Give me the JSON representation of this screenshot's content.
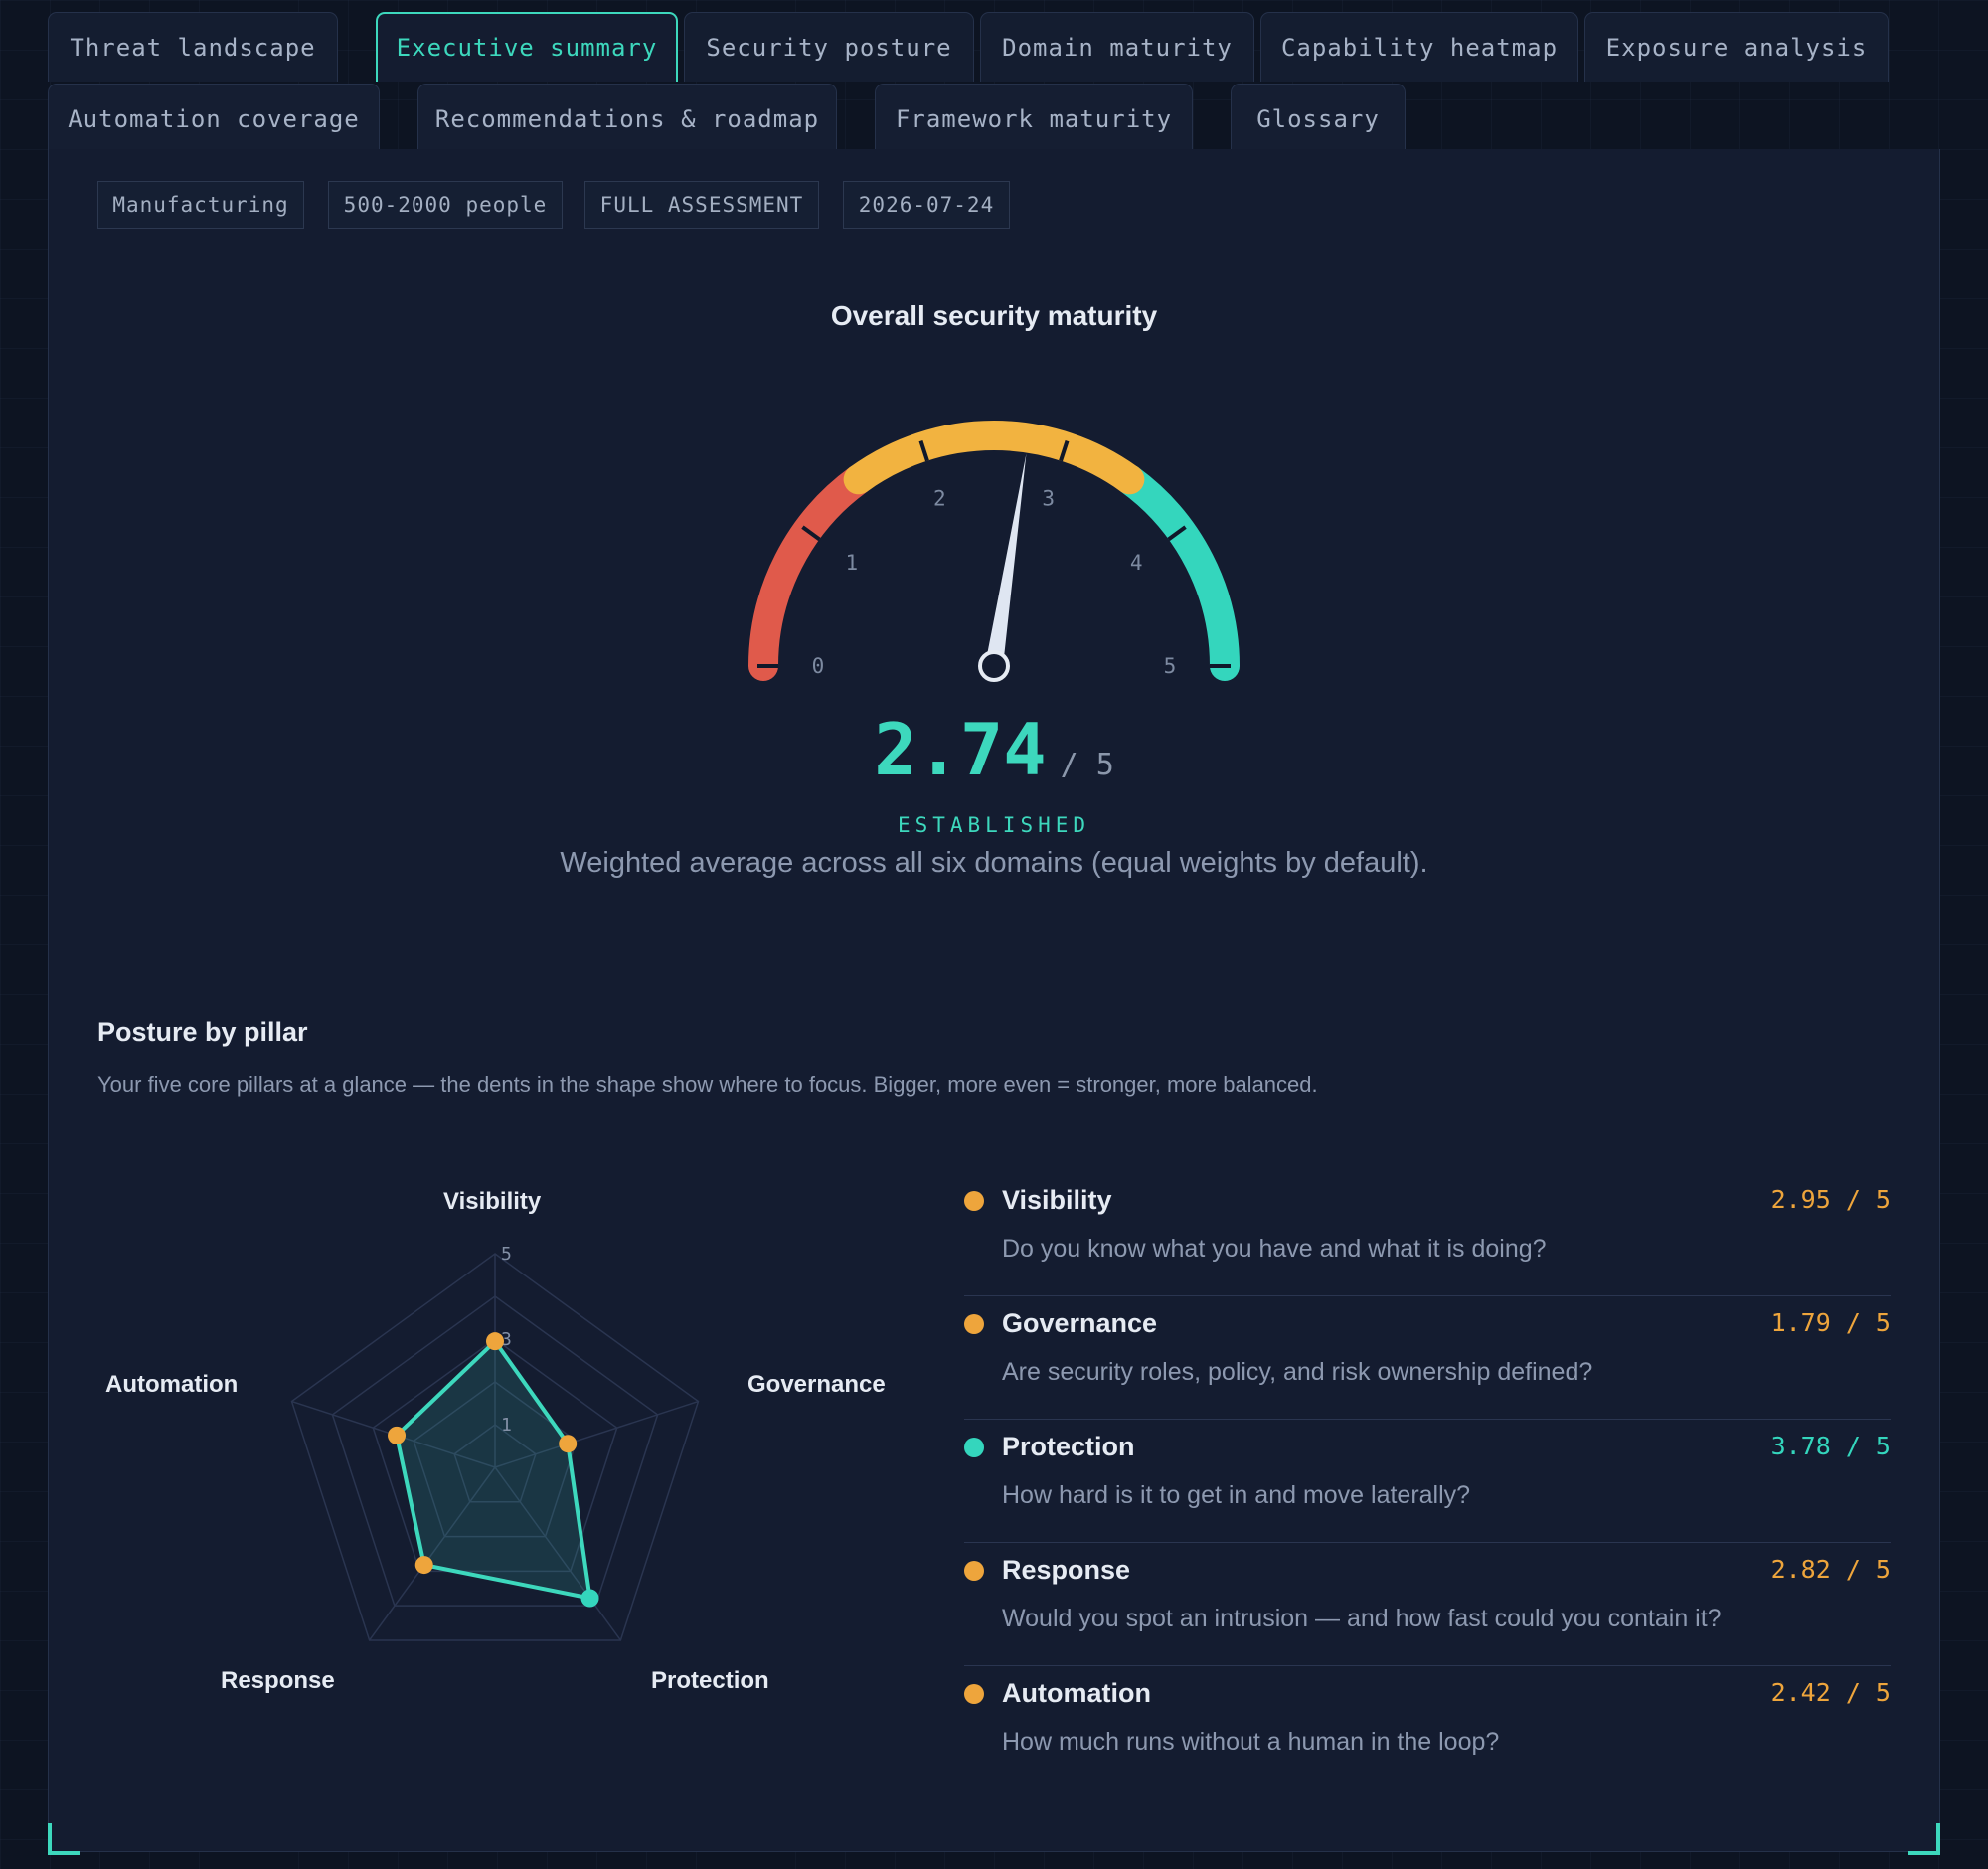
{
  "tabs_row1": [
    {
      "label": "Threat landscape",
      "active": false
    },
    {
      "label": "Executive summary",
      "active": true
    },
    {
      "label": "Security posture",
      "active": false
    },
    {
      "label": "Domain maturity",
      "active": false
    },
    {
      "label": "Capability heatmap",
      "active": false
    },
    {
      "label": "Exposure analysis",
      "active": false
    }
  ],
  "tabs_row2": [
    {
      "label": "Automation coverage",
      "active": false
    },
    {
      "label": "Recommendations & roadmap",
      "active": false
    },
    {
      "label": "Framework maturity",
      "active": false
    },
    {
      "label": "Glossary",
      "active": false
    }
  ],
  "chips": [
    "Manufacturing",
    "500-2000 people",
    "FULL ASSESSMENT",
    "2026-07-24"
  ],
  "gauge": {
    "title": "Overall security maturity",
    "value": 2.74,
    "value_text": "2.74",
    "max_text": "/ 5",
    "max": 5,
    "level": "ESTABLISHED",
    "note": "Weighted average across all six domains (equal weights by default).",
    "tick_labels": [
      "0",
      "1",
      "2",
      "3",
      "4",
      "5"
    ],
    "bands": [
      {
        "from": 0,
        "to": 1.5,
        "color": "#e05a4b"
      },
      {
        "from": 1.5,
        "to": 3.5,
        "color": "#f2b340"
      },
      {
        "from": 3.5,
        "to": 5,
        "color": "#34d6bd"
      }
    ],
    "needle_color": "#dfe6f2"
  },
  "pillars_section": {
    "title": "Posture by pillar",
    "description": "Your five core pillars at a glance — the dents in the shape show where to focus. Bigger, more even = stronger, more balanced."
  },
  "radar": {
    "max": 5,
    "ring_labels": [
      "1",
      "3",
      "5"
    ],
    "axes": [
      "Visibility",
      "Governance",
      "Protection",
      "Response",
      "Automation"
    ]
  },
  "chart_data": {
    "type": "radar",
    "categories": [
      "Visibility",
      "Governance",
      "Protection",
      "Response",
      "Automation"
    ],
    "values": [
      2.95,
      1.79,
      3.78,
      2.82,
      2.42
    ],
    "rlim": [
      0,
      5
    ]
  },
  "pillars": [
    {
      "name": "Visibility",
      "question": "Do you know what you have and what it is doing?",
      "score": "2.95 / 5",
      "color": "#eea53c"
    },
    {
      "name": "Governance",
      "question": "Are security roles, policy, and risk ownership defined?",
      "score": "1.79 / 5",
      "color": "#eea53c"
    },
    {
      "name": "Protection",
      "question": "How hard is it to get in and move laterally?",
      "score": "3.78 / 5",
      "color": "#34d6bd"
    },
    {
      "name": "Response",
      "question": "Would you spot an intrusion — and how fast could you contain it?",
      "score": "2.82 / 5",
      "color": "#eea53c"
    },
    {
      "name": "Automation",
      "question": "How much runs without a human in the loop?",
      "score": "2.42 / 5",
      "color": "#eea53c"
    }
  ],
  "colors": {
    "accent": "#3dd8bd",
    "warn": "#eea53c",
    "danger": "#e05a4b"
  }
}
